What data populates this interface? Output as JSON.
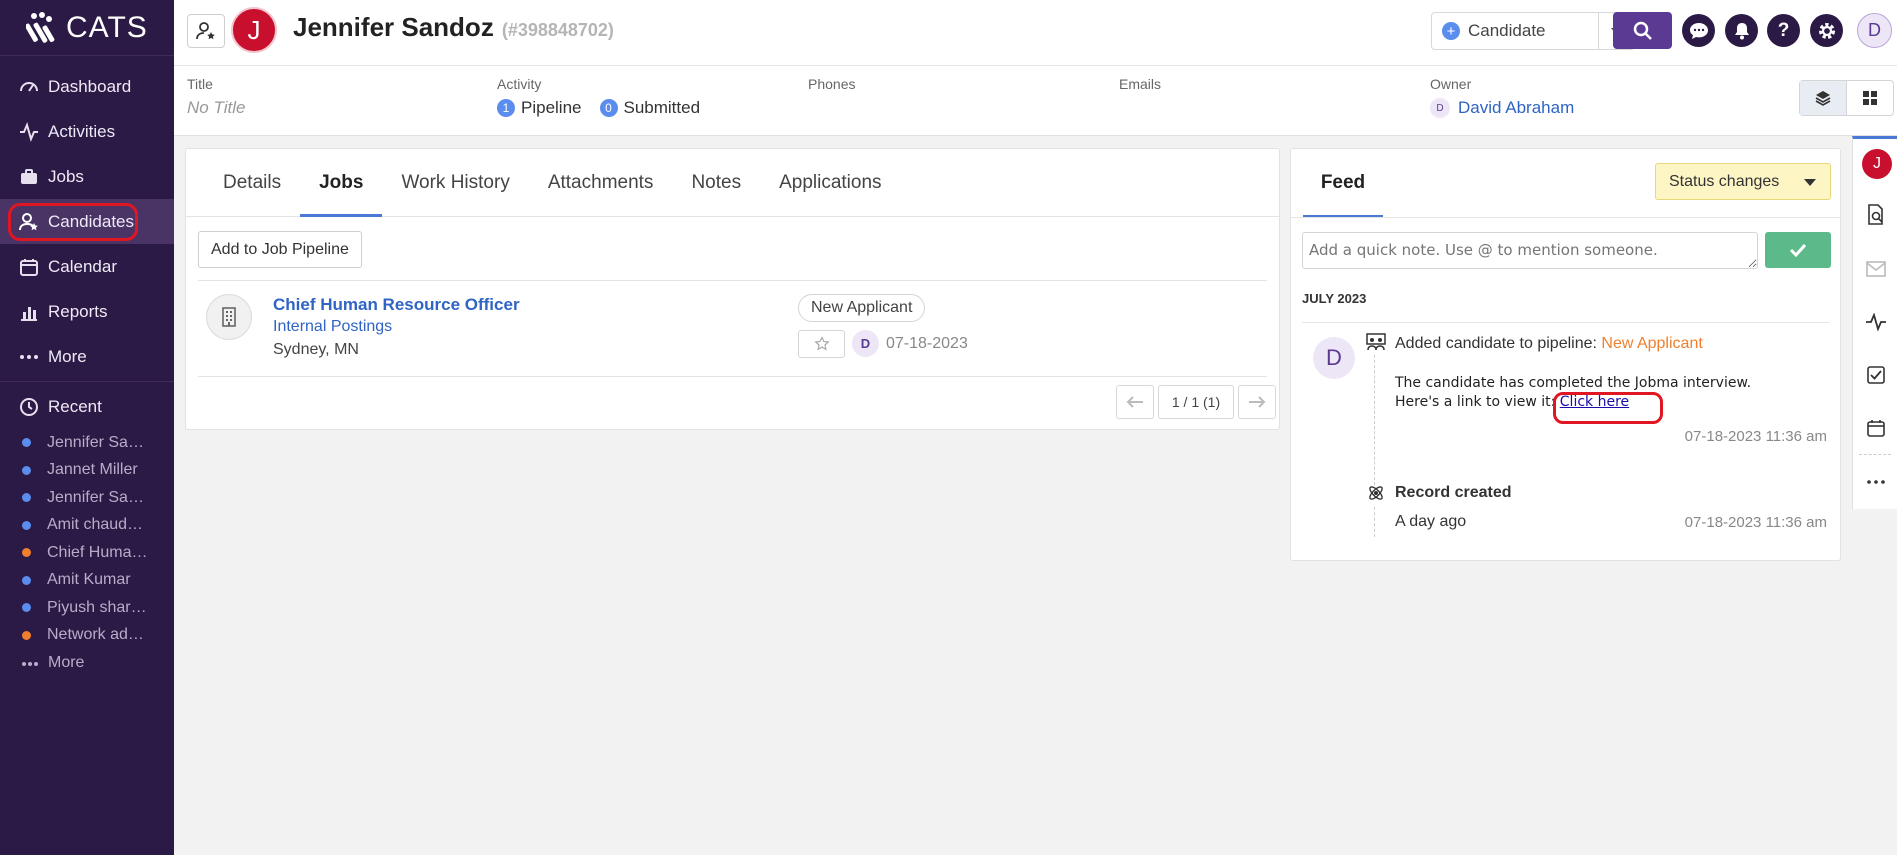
{
  "brand": {
    "logo_text": "CATS"
  },
  "sidebar": {
    "nav": [
      {
        "label": "Dashboard",
        "icon": "dashboard-icon"
      },
      {
        "label": "Activities",
        "icon": "activity-icon"
      },
      {
        "label": "Jobs",
        "icon": "briefcase-icon"
      },
      {
        "label": "Candidates",
        "icon": "candidate-icon",
        "active": true
      },
      {
        "label": "Calendar",
        "icon": "calendar-icon"
      },
      {
        "label": "Reports",
        "icon": "chart-icon"
      },
      {
        "label": "More",
        "icon": "ellipsis-icon"
      }
    ],
    "recent_label": "Recent",
    "recent": [
      {
        "label": "Jennifer Sa…",
        "color": "#5b8def"
      },
      {
        "label": "Jannet Miller",
        "color": "#5b8def"
      },
      {
        "label": "Jennifer Sa…",
        "color": "#5b8def"
      },
      {
        "label": "Amit chaud…",
        "color": "#5b8def"
      },
      {
        "label": "Chief Huma…",
        "color": "#f07f2e"
      },
      {
        "label": "Amit Kumar",
        "color": "#5b8def"
      },
      {
        "label": "Piyush shar…",
        "color": "#5b8def"
      },
      {
        "label": "Network ad…",
        "color": "#f07f2e"
      }
    ],
    "recent_more": "More"
  },
  "header": {
    "avatar_letter": "J",
    "candidate_name": "Jennifer Sandoz",
    "candidate_id": "(#398848702)",
    "record_type": "Candidate",
    "user_initial": "D"
  },
  "info": {
    "title_label": "Title",
    "title_value": "No Title",
    "activity_label": "Activity",
    "pipeline_count": "1",
    "pipeline_label": "Pipeline",
    "submitted_count": "0",
    "submitted_label": "Submitted",
    "phones_label": "Phones",
    "emails_label": "Emails",
    "owner_label": "Owner",
    "owner_initial": "D",
    "owner_name": "David Abraham"
  },
  "tabs": [
    "Details",
    "Jobs",
    "Work History",
    "Attachments",
    "Notes",
    "Applications"
  ],
  "jobs": {
    "add_button": "Add to Job Pipeline",
    "items": [
      {
        "title": "Chief Human Resource Officer",
        "company": "Internal Postings",
        "location": "Sydney, MN",
        "status": "New Applicant",
        "user_initial": "D",
        "date": "07-18-2023"
      }
    ],
    "pager": "1 / 1 (1)"
  },
  "feed": {
    "tab_label": "Feed",
    "filter_label": "Status changes",
    "note_placeholder": "Add a quick note. Use @ to mention someone.",
    "month": "JULY 2023",
    "entries": [
      {
        "avatar": "D",
        "title_prefix": "Added candidate to pipeline:",
        "title_highlight": "New Applicant",
        "body_line1": "The candidate has completed the Jobma interview.",
        "body_line2": "Here's a link to view it:",
        "link_text": "Click here",
        "time": "07-18-2023 11:36 am"
      },
      {
        "title": "Record created",
        "subtitle": "A day ago",
        "time": "07-18-2023 11:36 am"
      }
    ]
  },
  "rail": {
    "avatar_letter": "J"
  }
}
